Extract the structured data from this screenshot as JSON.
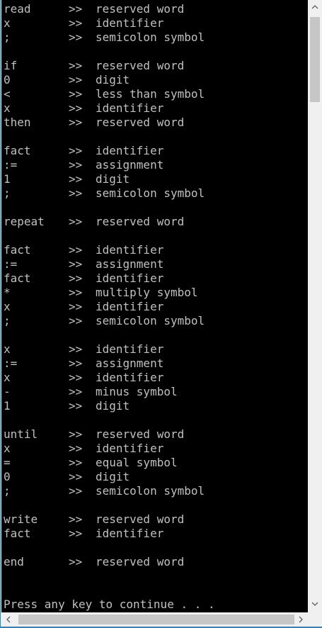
{
  "console": {
    "separator": ">>",
    "lines": [
      {
        "token": "read",
        "type": "reserved word"
      },
      {
        "token": "x",
        "type": "identifier"
      },
      {
        "token": ";",
        "type": "semicolon symbol"
      },
      null,
      {
        "token": "if",
        "type": "reserved word"
      },
      {
        "token": "0",
        "type": "digit"
      },
      {
        "token": "<",
        "type": "less than symbol"
      },
      {
        "token": "x",
        "type": "identifier"
      },
      {
        "token": "then",
        "type": "reserved word"
      },
      null,
      {
        "token": "fact",
        "type": "identifier"
      },
      {
        "token": ":=",
        "type": "assignment"
      },
      {
        "token": "1",
        "type": "digit"
      },
      {
        "token": ";",
        "type": "semicolon symbol"
      },
      null,
      {
        "token": "repeat",
        "type": "reserved word"
      },
      null,
      {
        "token": "fact",
        "type": "identifier"
      },
      {
        "token": ":=",
        "type": "assignment"
      },
      {
        "token": "fact",
        "type": "identifier"
      },
      {
        "token": "*",
        "type": "multiply symbol"
      },
      {
        "token": "x",
        "type": "identifier"
      },
      {
        "token": ";",
        "type": "semicolon symbol"
      },
      null,
      {
        "token": "x",
        "type": "identifier"
      },
      {
        "token": ":=",
        "type": "assignment"
      },
      {
        "token": "x",
        "type": "identifier"
      },
      {
        "token": "-",
        "type": "minus symbol"
      },
      {
        "token": "1",
        "type": "digit"
      },
      null,
      {
        "token": "until",
        "type": "reserved word"
      },
      {
        "token": "x",
        "type": "identifier"
      },
      {
        "token": "=",
        "type": "equal symbol"
      },
      {
        "token": "0",
        "type": "digit"
      },
      {
        "token": ";",
        "type": "semicolon symbol"
      },
      null,
      {
        "token": "write",
        "type": "reserved word"
      },
      {
        "token": "fact",
        "type": "identifier"
      },
      null,
      {
        "token": "end",
        "type": "reserved word"
      }
    ],
    "prompt": "Press any key to continue . . ."
  },
  "scrollbars": {
    "up_icon": "chevron-up-icon",
    "down_icon": "chevron-down-icon",
    "left_icon": "chevron-left-icon",
    "right_icon": "chevron-right-icon"
  }
}
